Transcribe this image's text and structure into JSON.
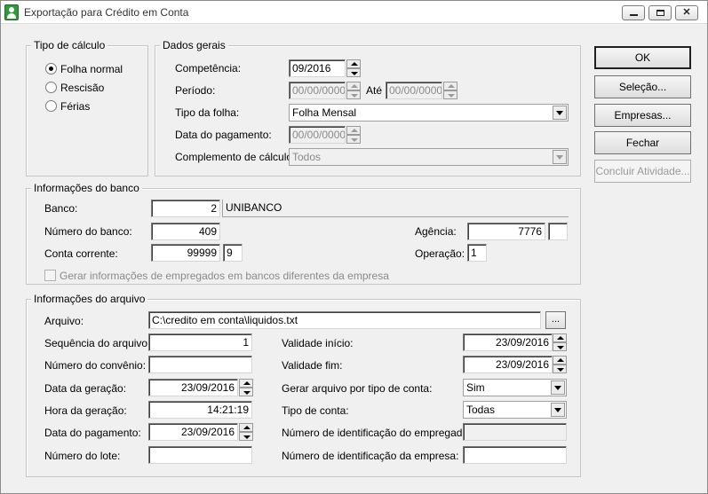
{
  "window": {
    "title": "Exportação para Crédito em Conta"
  },
  "tipo_calculo": {
    "legend": "Tipo de cálculo",
    "options": [
      {
        "label": "Folha normal",
        "checked": true
      },
      {
        "label": "Rescisão",
        "checked": false
      },
      {
        "label": "Férias",
        "checked": false
      }
    ]
  },
  "dados_gerais": {
    "legend": "Dados gerais",
    "competencia_label": "Competência:",
    "competencia": "09/2016",
    "periodo_label": "Período:",
    "periodo_de": "00/00/0000",
    "ate_label": "Até",
    "periodo_ate": "00/00/0000",
    "tipo_folha_label": "Tipo da folha:",
    "tipo_folha": "Folha Mensal",
    "data_pagamento_label": "Data do pagamento:",
    "data_pagamento": "00/00/0000",
    "complemento_label": "Complemento de cálculo:",
    "complemento": "Todos"
  },
  "banco": {
    "legend": "Informações do banco",
    "banco_label": "Banco:",
    "banco_codigo": "2",
    "banco_nome": "UNIBANCO",
    "numero_banco_label": "Número do banco:",
    "numero_banco": "409",
    "agencia_label": "Agência:",
    "agencia": "7776",
    "agencia_dv": "",
    "conta_label": "Conta corrente:",
    "conta": "99999",
    "conta_dv": "9",
    "operacao_label": "Operação:",
    "operacao": "1",
    "gerar_label": "Gerar informações de empregados em bancos diferentes da empresa"
  },
  "arquivo": {
    "legend": "Informações do arquivo",
    "arquivo_label": "Arquivo:",
    "arquivo": "C:\\credito em conta\\liquidos.txt",
    "browse": "...",
    "sequencia_label": "Sequência do arquivo:",
    "sequencia": "1",
    "convenio_label": "Número do convênio:",
    "convenio": "",
    "data_geracao_label": "Data da geração:",
    "data_geracao": "23/09/2016",
    "hora_geracao_label": "Hora da geração:",
    "hora_geracao": "14:21:19",
    "data_pagamento_label": "Data do pagamento:",
    "data_pagamento": "23/09/2016",
    "lote_label": "Número do lote:",
    "lote": "",
    "validade_inicio_label": "Validade início:",
    "validade_inicio": "23/09/2016",
    "validade_fim_label": "Validade fim:",
    "validade_fim": "23/09/2016",
    "gerar_tipo_label": "Gerar arquivo por tipo de conta:",
    "gerar_tipo": "Sim",
    "tipo_conta_label": "Tipo de conta:",
    "tipo_conta": "Todas",
    "id_empregado_label": "Número de identificação do empregado:",
    "id_empregado": "",
    "id_empresa_label": "Número de identificação da empresa:",
    "id_empresa": ""
  },
  "buttons": {
    "ok": "OK",
    "selecao": "Seleção...",
    "empresas": "Empresas...",
    "fechar": "Fechar",
    "concluir": "Concluir Atividade..."
  }
}
